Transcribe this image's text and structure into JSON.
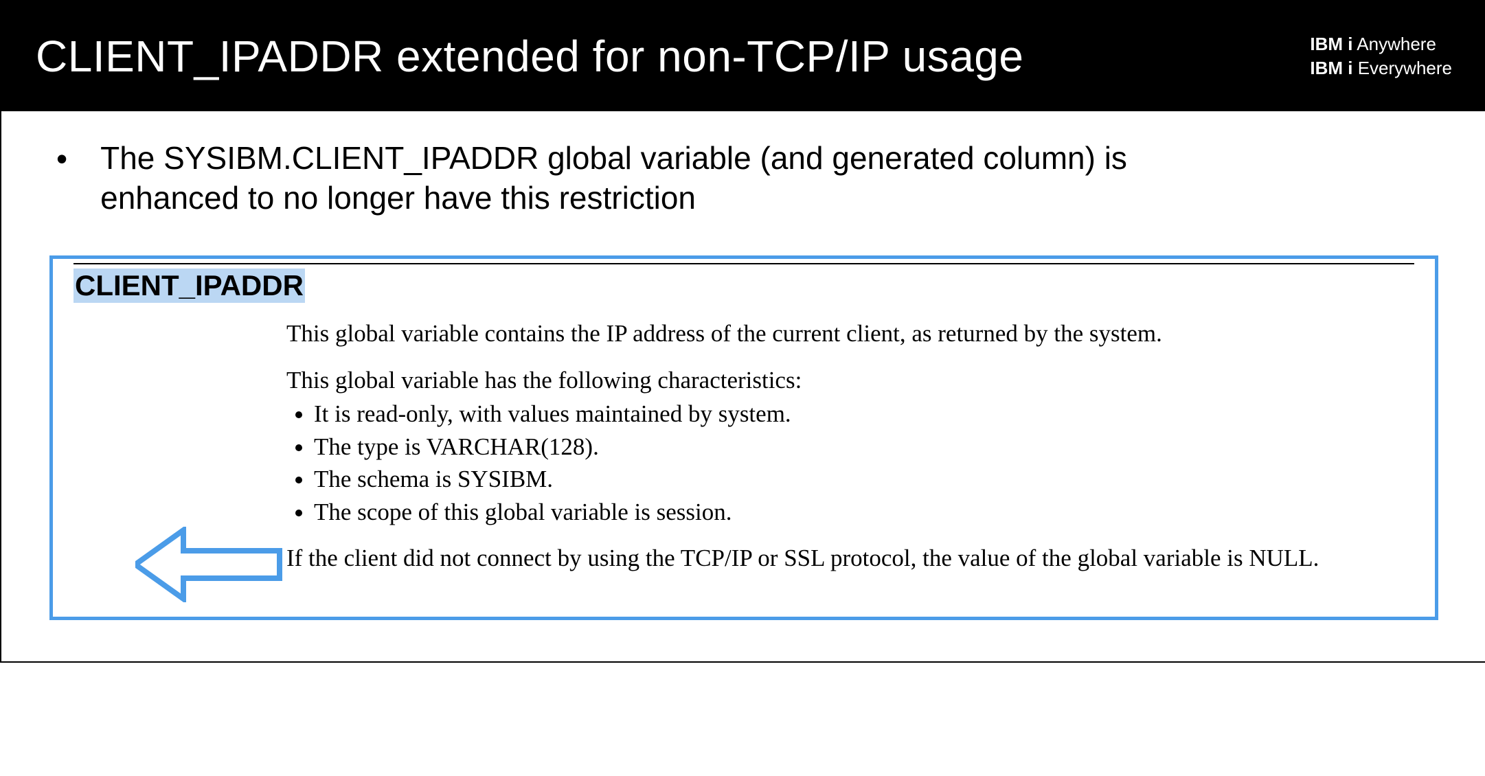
{
  "header": {
    "title": "CLIENT_IPADDR extended for non-TCP/IP usage",
    "brand": {
      "line1_ibm": "IBM",
      "line1_i": "i",
      "line1_tag": "Anywhere",
      "line2_ibm": "IBM",
      "line2_i": "i",
      "line2_tag": "Everywhere"
    }
  },
  "bullet": {
    "text": "The SYSIBM.CLIENT_IPADDR global variable (and generated column) is enhanced to no longer have this restriction"
  },
  "doc": {
    "heading": "CLIENT_IPADDR",
    "p1": "This global variable contains the IP address of the current client, as returned by the system.",
    "intro_chars": "This global variable has the following characteristics:",
    "chars": [
      "It is read-only, with values maintained by system.",
      "The type is VARCHAR(128).",
      "The schema is SYSIBM.",
      "The scope of this global variable is session."
    ],
    "p_last": "If the client did not connect by using the TCP/IP or SSL protocol, the value of the global variable is NULL."
  },
  "colors": {
    "accent_blue": "#4B9CE8",
    "highlight_blue": "#BBD7F3"
  }
}
